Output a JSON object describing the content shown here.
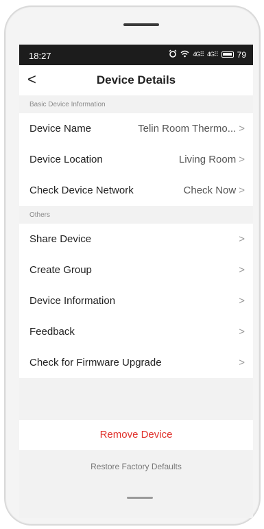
{
  "status_bar": {
    "time": "18:27",
    "net1": "4G",
    "net2": "4G",
    "battery": "79"
  },
  "header": {
    "back": "<",
    "title": "Device Details"
  },
  "basic_section": {
    "label": "Basic Device Information",
    "rows": [
      {
        "label": "Device Name",
        "value": "Telin Room Thermo..."
      },
      {
        "label": "Device Location",
        "value": "Living Room"
      },
      {
        "label": "Check Device Network",
        "value": "Check Now"
      }
    ]
  },
  "others_section": {
    "label": "Others",
    "rows": [
      {
        "label": "Share Device"
      },
      {
        "label": "Create Group"
      },
      {
        "label": "Device Information"
      },
      {
        "label": "Feedback"
      },
      {
        "label": "Check for Firmware Upgrade"
      }
    ]
  },
  "chevron": ">",
  "remove_device": "Remove Device",
  "restore_defaults": "Restore Factory Defaults",
  "colors": {
    "remove": "#e0302a",
    "statusbar": "#1c1c1c"
  }
}
